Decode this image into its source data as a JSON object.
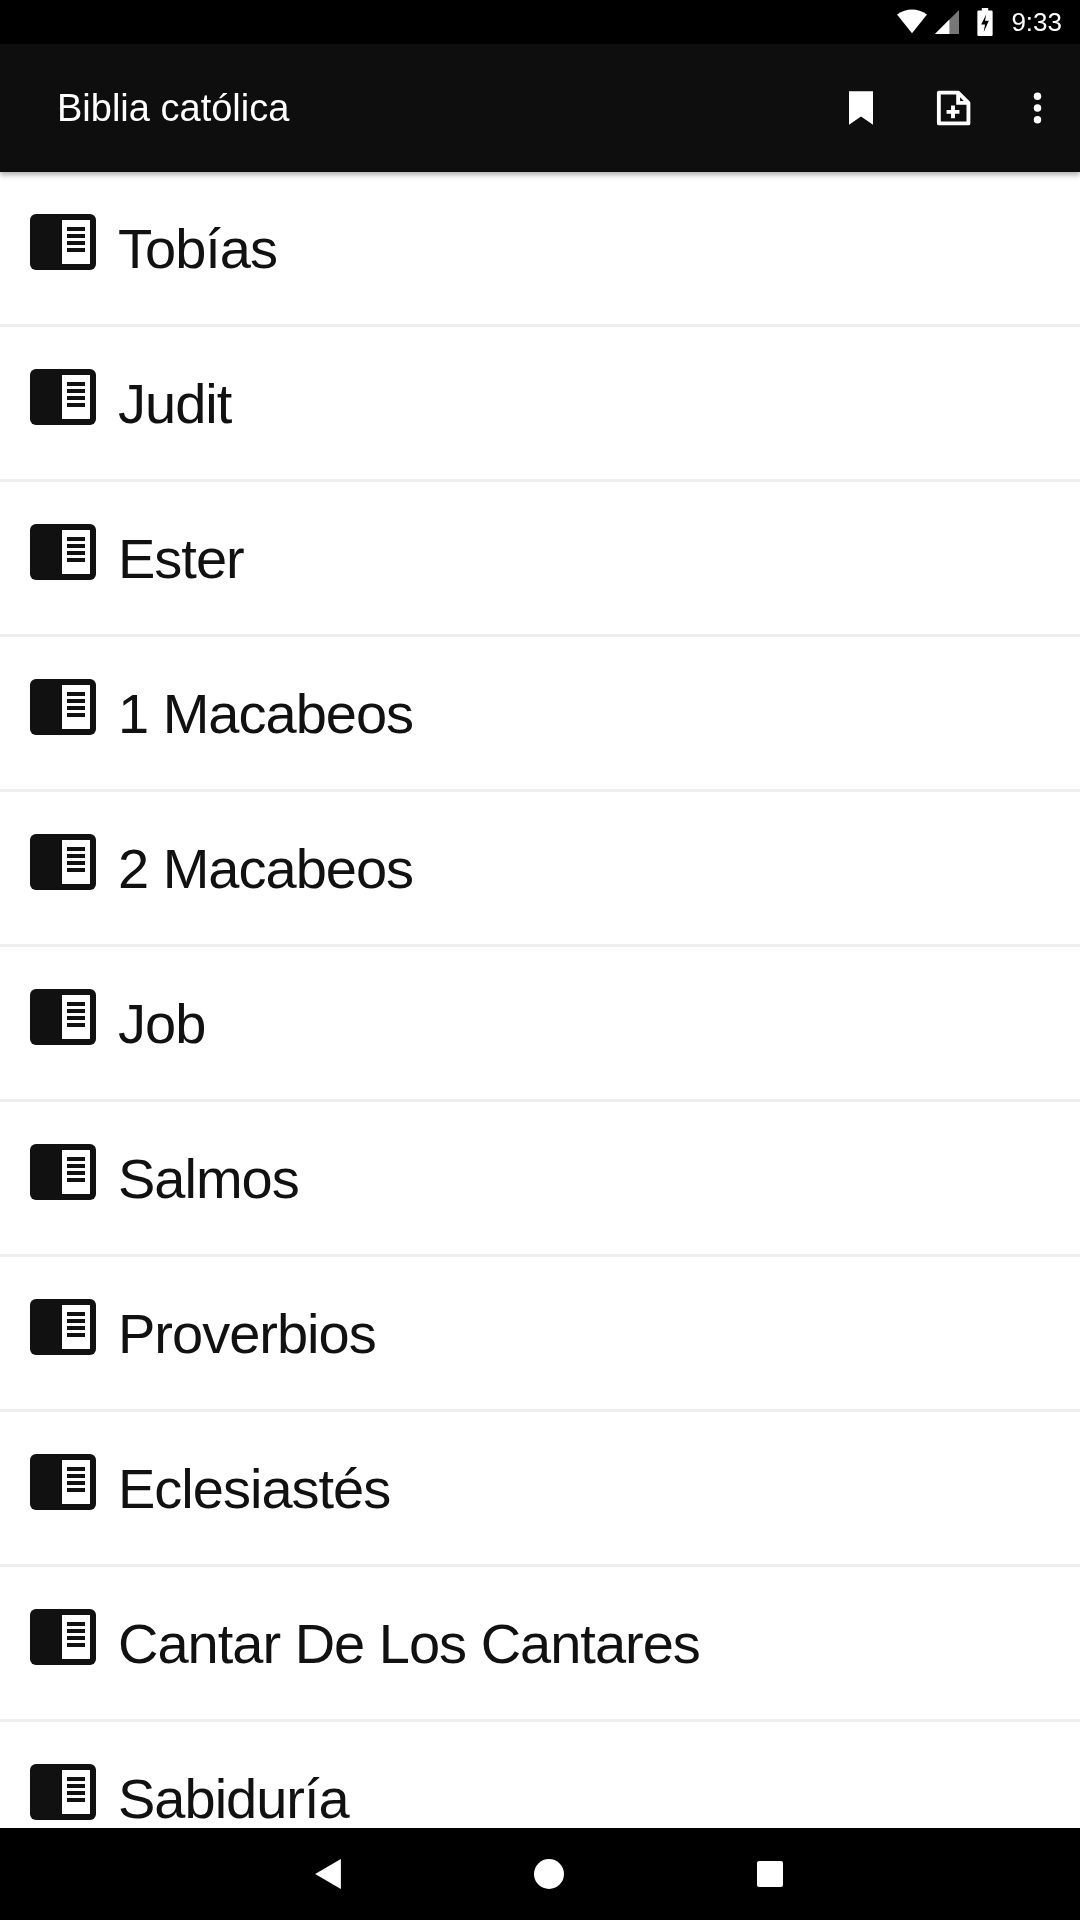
{
  "status_bar": {
    "time": "9:33"
  },
  "app_bar": {
    "title": "Biblia católica"
  },
  "books": [
    {
      "name": "Tobías"
    },
    {
      "name": "Judit"
    },
    {
      "name": "Ester"
    },
    {
      "name": "1 Macabeos"
    },
    {
      "name": "2 Macabeos"
    },
    {
      "name": "Job"
    },
    {
      "name": "Salmos"
    },
    {
      "name": "Proverbios"
    },
    {
      "name": "Eclesiastés"
    },
    {
      "name": "Cantar De Los Cantares"
    },
    {
      "name": "Sabiduría"
    }
  ]
}
